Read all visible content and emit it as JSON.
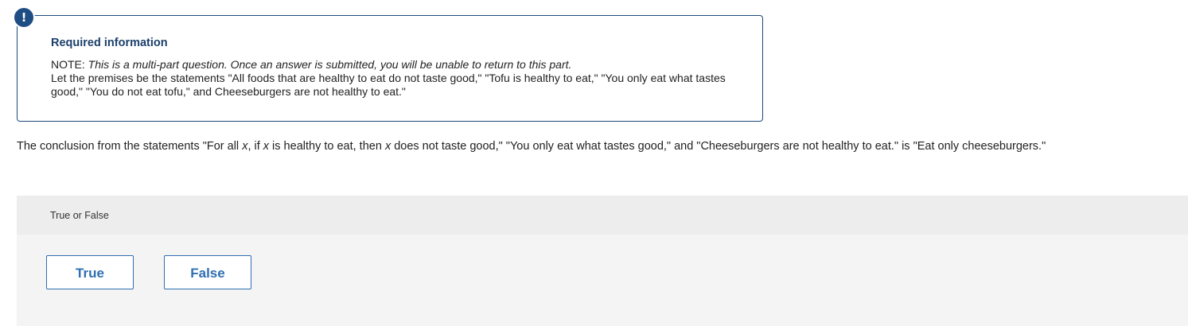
{
  "info": {
    "icon": "exclamation-icon",
    "icon_glyph": "!",
    "title": "Required information",
    "note_label": "NOTE:",
    "note_text": "This is a multi-part question. Once an answer is submitted, you will be unable to return to this part.",
    "premises_text": "Let the premises be the statements \"All foods that are healthy to eat do not taste good,\" \"Tofu is healthy to eat,\" \"You only eat what tastes good,\" \"You do not eat tofu,\" and Cheeseburgers are not healthy to eat.\""
  },
  "question": {
    "part1": "The conclusion from the statements \"For all ",
    "var1": "x",
    "part2": ", if ",
    "var2": "x",
    "part3": " is healthy to eat, then ",
    "var3": "x",
    "part4": " does not taste good,\" \"You only eat what tastes good,\" and \"Cheeseburgers are not healthy to eat.\" is \"Eat only cheeseburgers.\""
  },
  "answer": {
    "header": "True or False",
    "options": [
      "True",
      "False"
    ]
  },
  "colors": {
    "accent": "#2f6fb1",
    "info_border": "#1b4a7a",
    "icon_bg": "#1f4e85"
  }
}
